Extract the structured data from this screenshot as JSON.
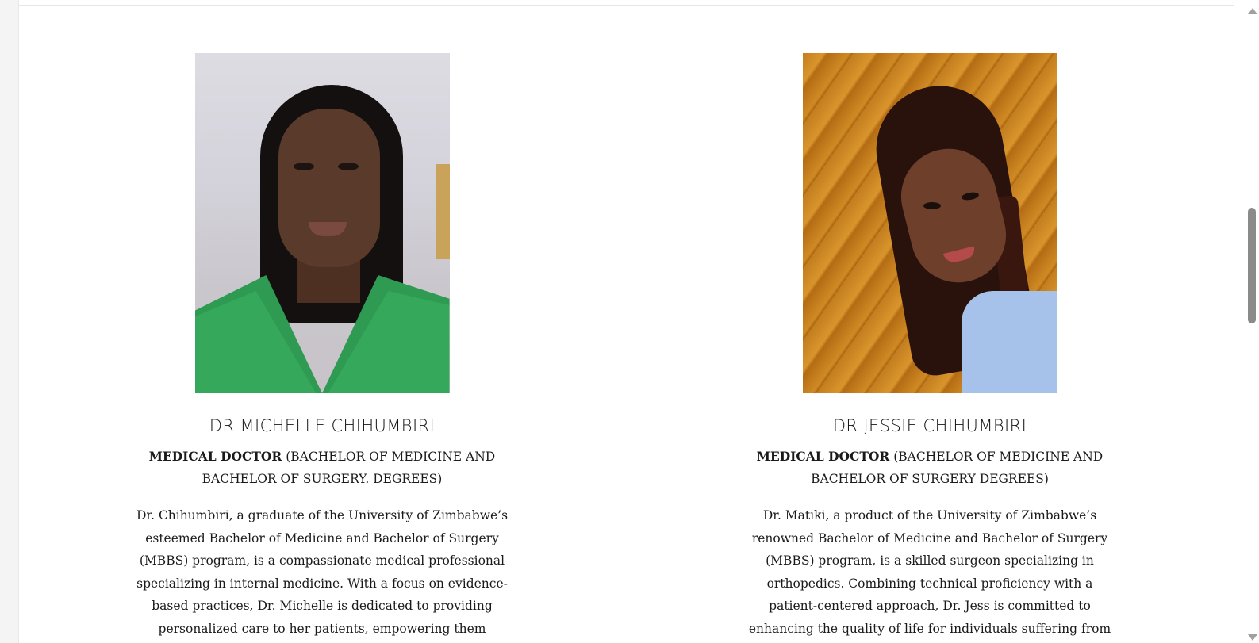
{
  "doctors": [
    {
      "name": "DR MICHELLE CHIHUMBIRI",
      "title_bold": "MEDICAL DOCTOR",
      "title_rest": " (BACHELOR OF MEDICINE AND BACHELOR OF SURGERY. DEGREES)",
      "bio": "Dr. Chihumbiri, a graduate of the University of Zimbabwe’s esteemed Bachelor of Medicine and Bachelor of Surgery (MBBS) program, is a compassionate medical professional specializing in internal medicine. With a focus on evidence-based practices, Dr. Michelle is dedicated to providing personalized care to her patients, empowering them through education and support."
    },
    {
      "name": "DR JESSIE CHIHUMBIRI",
      "title_bold": "MEDICAL DOCTOR",
      "title_rest": " (BACHELOR OF MEDICINE AND BACHELOR OF SURGERY DEGREES)",
      "bio": "Dr. Matiki, a product of the University of Zimbabwe’s renowned Bachelor of Medicine and Bachelor of Surgery (MBBS) program, is a skilled surgeon specializing in orthopedics. Combining technical proficiency with a patient-centered approach, Dr. Jess is committed to enhancing the quality of life for individuals suffering from musculoskeletal conditions through innovative"
    }
  ]
}
